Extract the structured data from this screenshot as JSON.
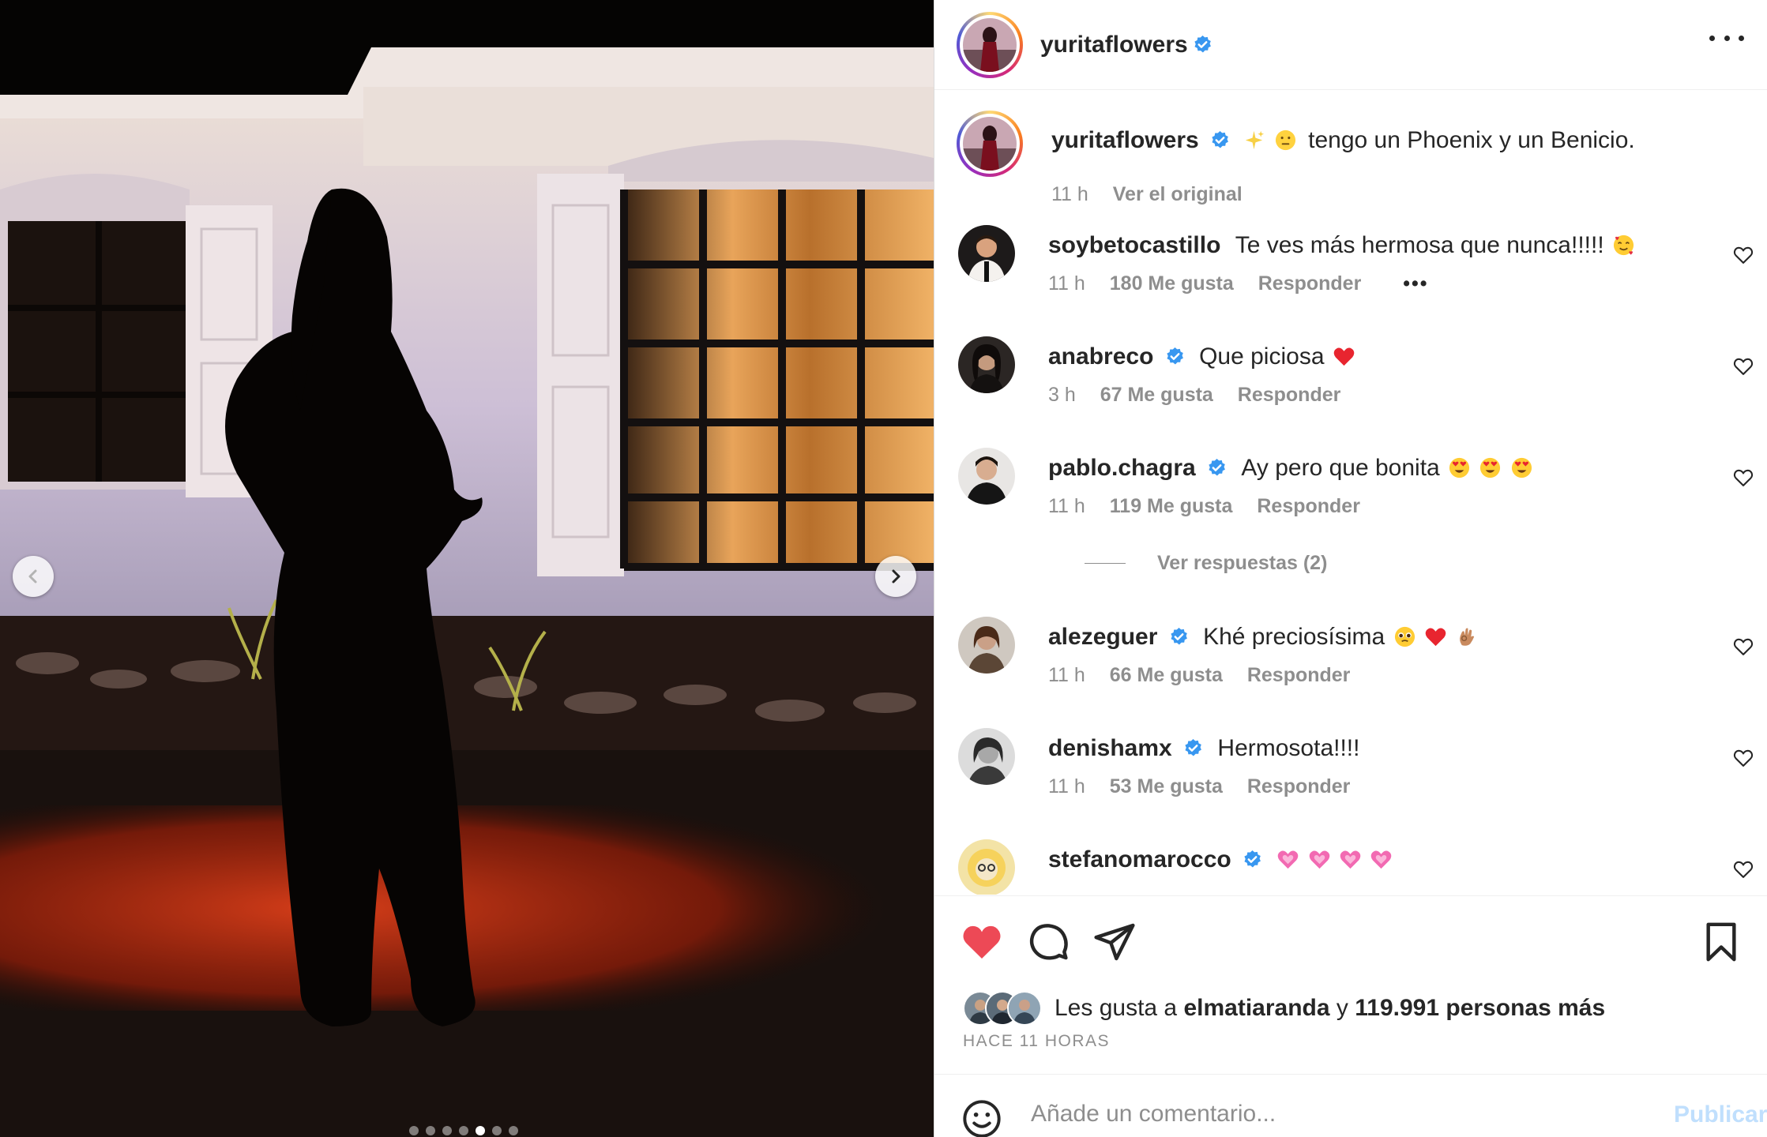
{
  "post": {
    "author": "yuritaflowers",
    "photo_alt_icon": "post-photo"
  },
  "carousel": {
    "slide_count": 7,
    "active_index": 4
  },
  "caption": {
    "username": "yuritaflowers",
    "text": "tengo un Phoenix y un Benicio.",
    "time": "11 h",
    "see_original": "Ver el original"
  },
  "comments": [
    {
      "username": "soybetocastillo",
      "verified": false,
      "text": "Te ves más hermosa que nunca!!!!!",
      "time": "11 h",
      "likes": "180 Me gusta",
      "reply": "Responder",
      "more": "•••"
    },
    {
      "username": "anabreco",
      "verified": true,
      "text": "Que piciosa",
      "time": "3 h",
      "likes": "67 Me gusta",
      "reply": "Responder"
    },
    {
      "username": "pablo.chagra",
      "verified": true,
      "text": "Ay pero que bonita",
      "time": "11 h",
      "likes": "119 Me gusta",
      "reply": "Responder"
    },
    {
      "username": "alezeguer",
      "verified": true,
      "text": "Khé preciosísima",
      "time": "11 h",
      "likes": "66 Me gusta",
      "reply": "Responder"
    },
    {
      "username": "denishamx",
      "verified": true,
      "text": "Hermosota!!!!",
      "time": "11 h",
      "likes": "53 Me gusta",
      "reply": "Responder"
    },
    {
      "username": "stefanomarocco",
      "verified": true,
      "text": "",
      "time": "",
      "likes": "",
      "reply": ""
    }
  ],
  "view_replies": "Ver respuestas (2)",
  "likes": {
    "prefix": "Les gusta a",
    "user": "elmatiaranda",
    "conj": "y",
    "count": "119.991 personas más"
  },
  "time_ago": "HACE 11 HORAS",
  "comment_box": {
    "placeholder": "Añade un comentario...",
    "publish": "Publicar"
  },
  "colors": {
    "like_red": "#ed4956",
    "verified_blue": "#3897f0",
    "muted": "#8e8e8e",
    "publish_disabled": "#c0dffd"
  }
}
